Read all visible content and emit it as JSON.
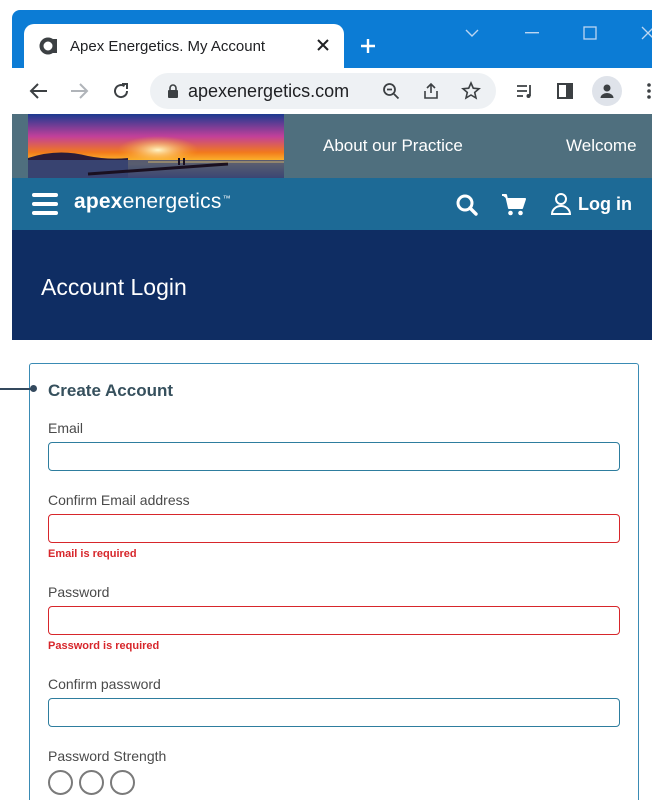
{
  "browser": {
    "tab_title": "Apex Energetics. My Account",
    "url": "apexenergetics.com",
    "colors": {
      "frame": "#0c7cd5",
      "omnibox": "#eef1f4"
    }
  },
  "site": {
    "top_nav": [
      "About our Practice",
      "Welcome"
    ],
    "logo": {
      "bold": "apex",
      "regular": "energetics",
      "tm": "™"
    },
    "login_label": "Log in",
    "colors": {
      "top_bar": "#4f6f7e",
      "nav_bar": "#1d6a96",
      "hero": "#0f2d63",
      "error": "#d7262b"
    }
  },
  "hero": {
    "title": "Account Login"
  },
  "form": {
    "title": "Create Account",
    "email": {
      "label": "Email",
      "value": ""
    },
    "confirm_email": {
      "label": "Confirm Email address",
      "value": "",
      "error": "Email is required"
    },
    "password": {
      "label": "Password",
      "value": "",
      "error": "Password is required"
    },
    "confirm_password": {
      "label": "Confirm password",
      "value": ""
    },
    "password_strength": {
      "label": "Password Strength",
      "level": 0,
      "max": 3
    }
  }
}
